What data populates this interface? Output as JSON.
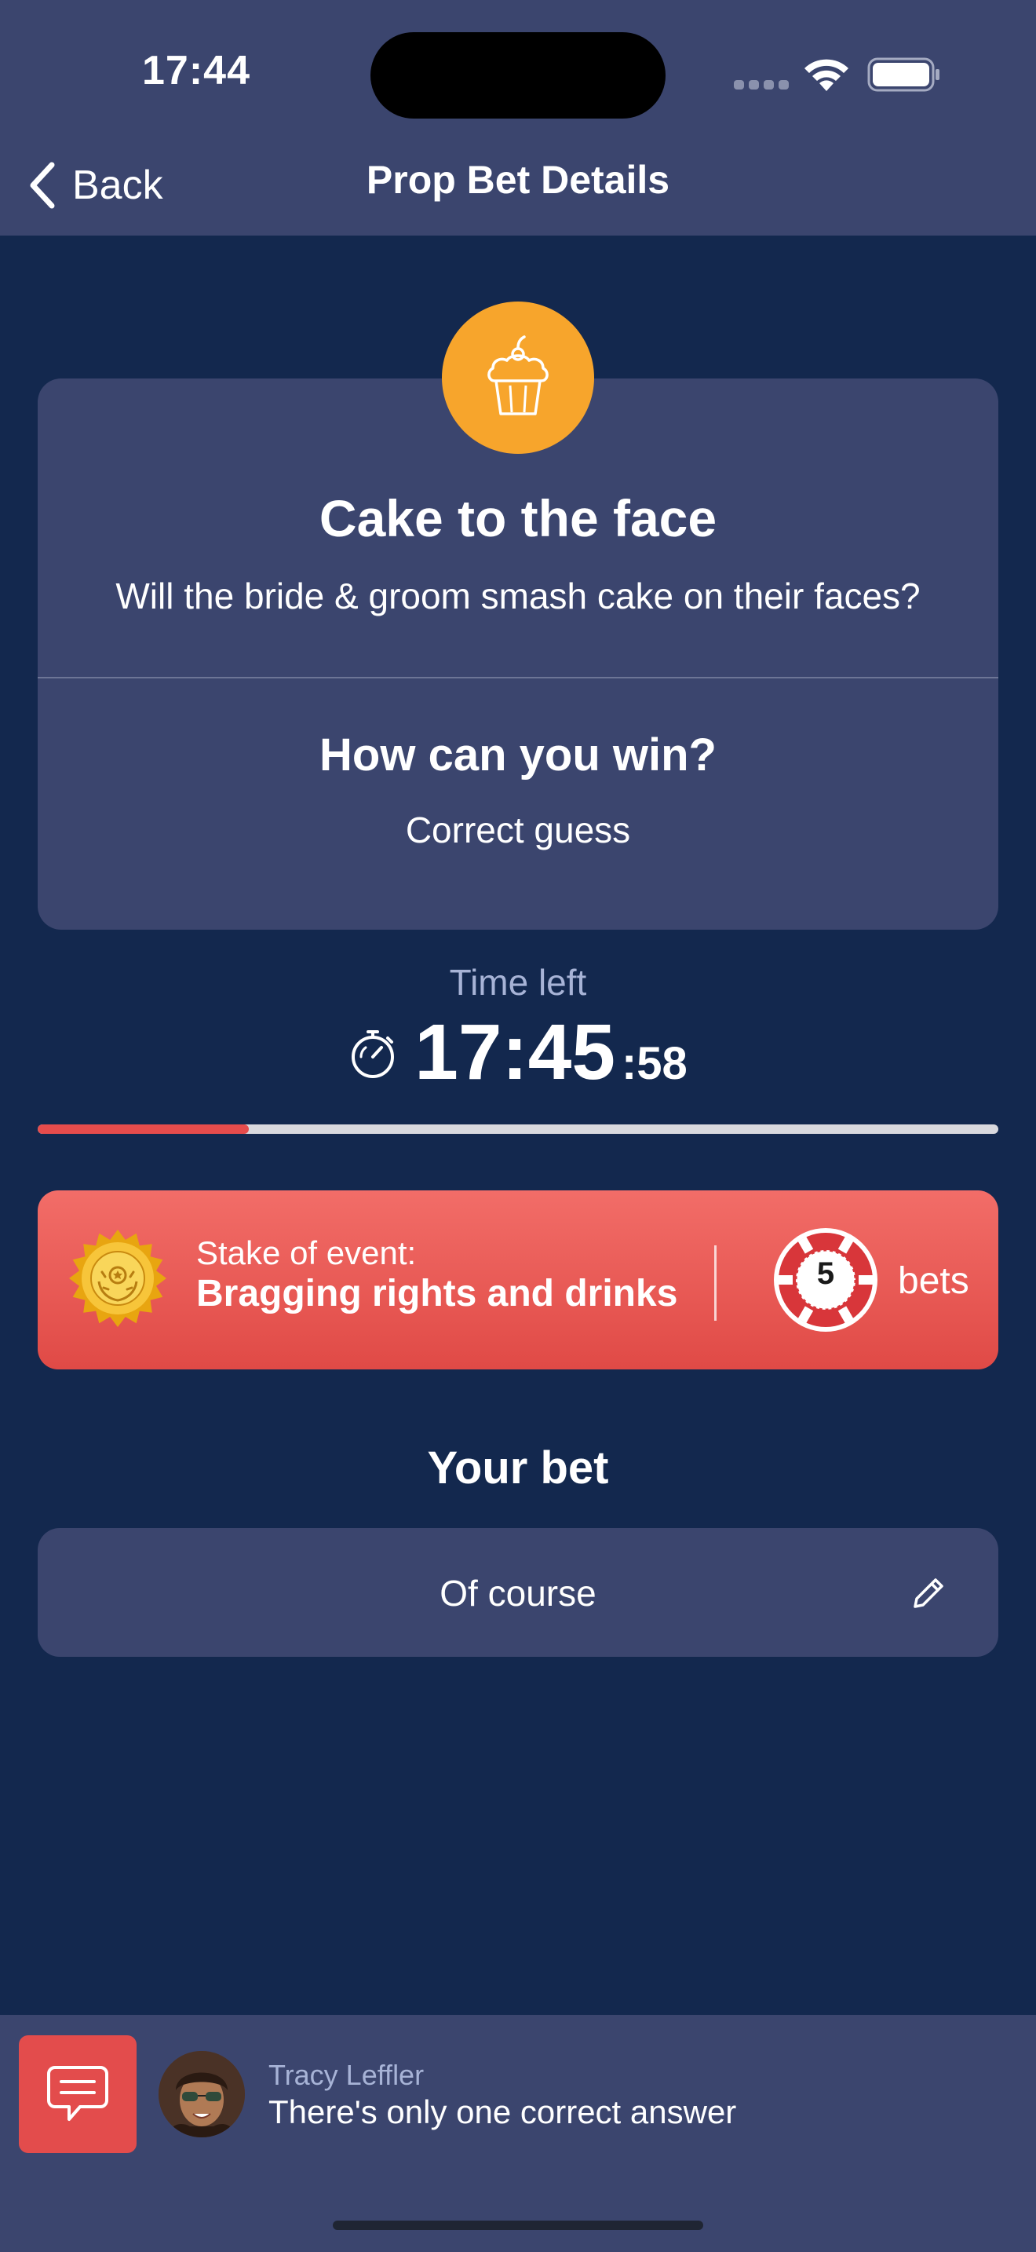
{
  "status_bar": {
    "time": "17:44"
  },
  "nav": {
    "back_label": "Back",
    "title": "Prop Bet Details"
  },
  "bet": {
    "icon": "cupcake-icon",
    "title": "Cake to the face",
    "question": "Will the bride & groom smash cake on their faces?",
    "win_heading": "How can you win?",
    "win_condition": "Correct guess"
  },
  "timer": {
    "label": "Time left",
    "main": "17:45",
    "seconds": ":58",
    "progress": 0.22,
    "progress_color": "#e64c4c"
  },
  "stake": {
    "label": "Stake of event:",
    "value": "Bragging rights and drinks",
    "bets_count": "5",
    "bets_label": "bets",
    "banner_color": "#e85a56"
  },
  "your_bet": {
    "heading": "Your bet",
    "value": "Of course"
  },
  "comment": {
    "author": "Tracy Leffler",
    "text": "There's only one correct answer"
  },
  "colors": {
    "background": "#13284e",
    "card": "#3b456e",
    "accent_orange": "#f7a52c",
    "accent_red": "#e34c4c"
  }
}
